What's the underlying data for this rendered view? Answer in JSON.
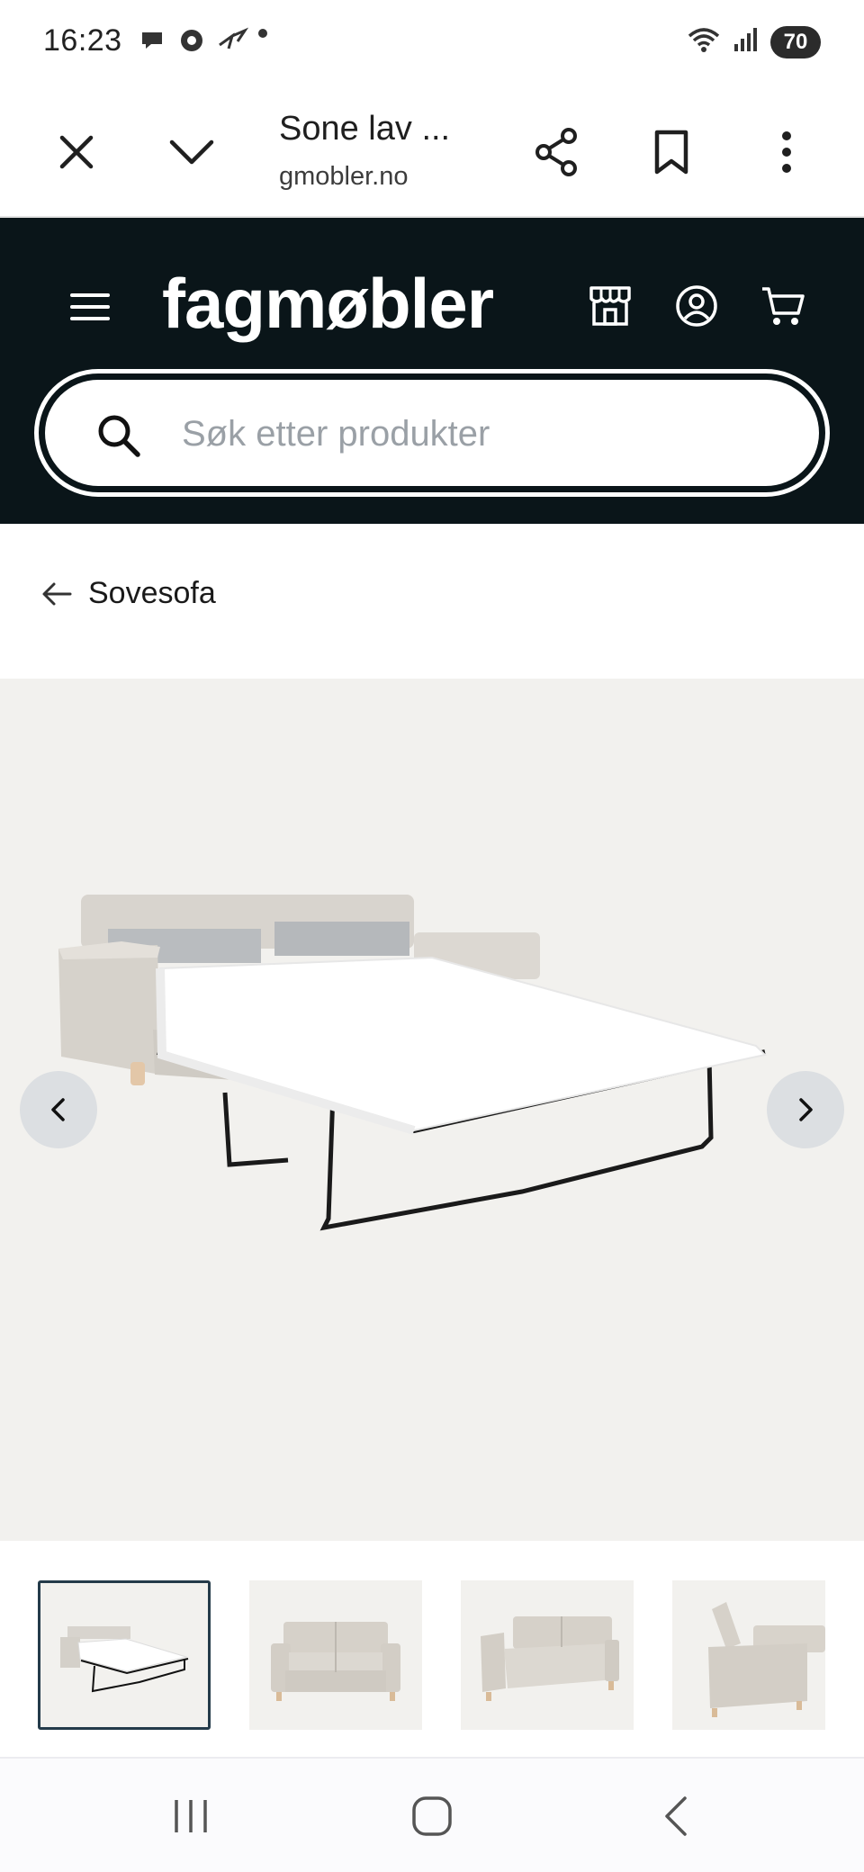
{
  "status_bar": {
    "time": "16:23",
    "battery": "70"
  },
  "browser": {
    "tab_title": "Sone lav ...",
    "url": "gmobler.no"
  },
  "site": {
    "logo": "fagmøbler",
    "search_placeholder": "Søk etter produkter"
  },
  "breadcrumb": {
    "label": "Sovesofa"
  },
  "colors": {
    "header_bg": "#0a1519",
    "gallery_bg": "#f2f1ee",
    "active_thumb_border": "#243b4a"
  },
  "gallery": {
    "thumbnails": [
      {
        "name": "sofa-bed-open"
      },
      {
        "name": "sofa-front"
      },
      {
        "name": "sofa-angle"
      },
      {
        "name": "sofa-side"
      }
    ],
    "active_index": 0
  }
}
